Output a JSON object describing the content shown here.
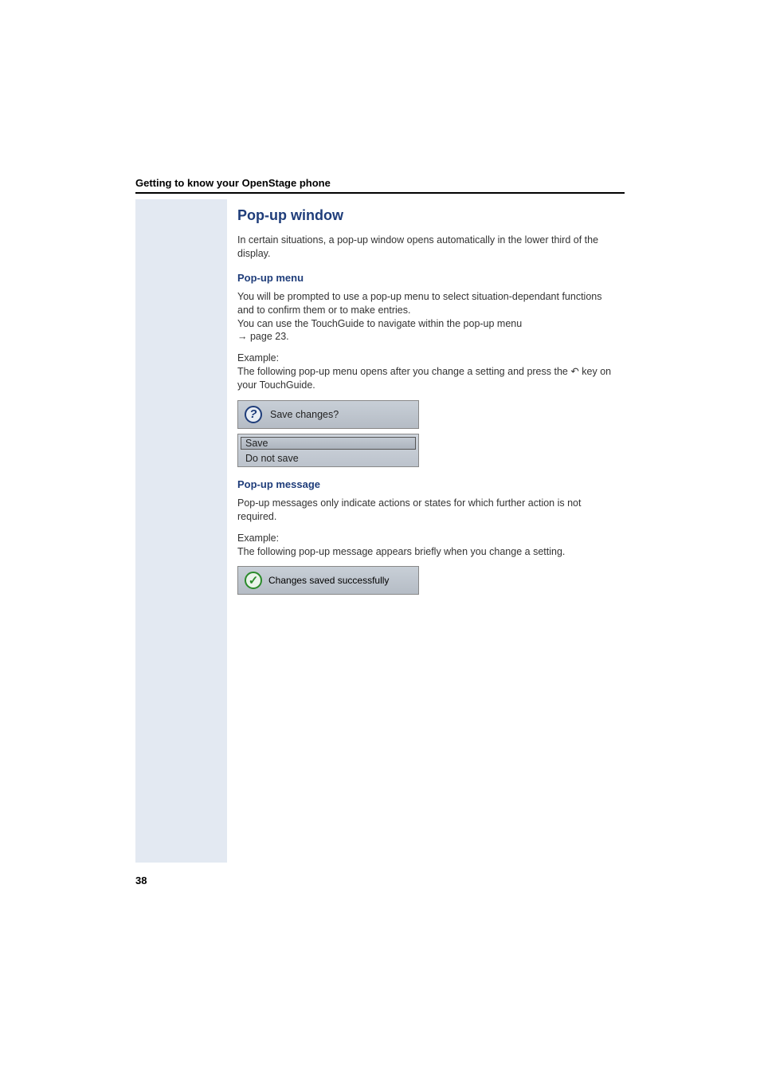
{
  "header": {
    "title": "Getting to know your OpenStage phone"
  },
  "section": {
    "title": "Pop-up window",
    "intro": "In certain situations, a pop-up window opens automatically in the lower third of the display."
  },
  "popup_menu": {
    "heading": "Pop-up menu",
    "para1": "You will be prompted to use a pop-up menu to select situation-dependant functions and to confirm them or to make entries.",
    "para2": "You can use the TouchGuide to navigate within the pop-up menu",
    "page_ref": "page 23.",
    "example_label": "Example:",
    "example_text_before": "The following pop-up menu opens after you change a setting and press the ",
    "example_text_after": " key on your TouchGuide.",
    "dialog_title": "Save changes?",
    "option_save": "Save",
    "option_no_save": "Do not save"
  },
  "popup_message": {
    "heading": "Pop-up message",
    "para1": "Pop-up messages only indicate actions or states for which further action is not required.",
    "example_label": "Example:",
    "example_text": "The following pop-up message appears briefly when you change a setting.",
    "message_text": "Changes saved successfully"
  },
  "icons": {
    "question": "?",
    "check": "✓",
    "arrow": "→",
    "back_key": "↶"
  },
  "page_number": "38"
}
